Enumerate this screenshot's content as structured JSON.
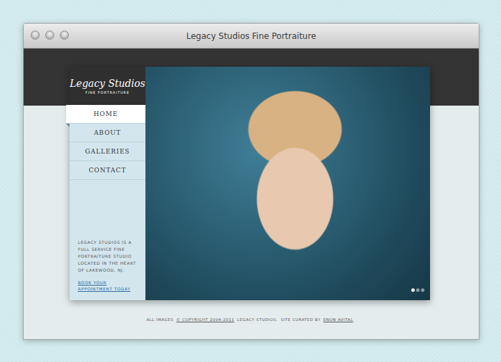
{
  "window": {
    "title": "Legacy Studios Fine Portraiture"
  },
  "logo": {
    "name": "Legacy Studios",
    "tagline": "FINE PORTRAITURE"
  },
  "nav": [
    {
      "label": "HOME",
      "selected": true
    },
    {
      "label": "ABOUT",
      "selected": false
    },
    {
      "label": "GALLERIES",
      "selected": false
    },
    {
      "label": "CONTACT",
      "selected": false
    }
  ],
  "sidebar": {
    "about": "LEGACY STUDIOS IS A FULL SERVICE FINE PORTRAITURE STUDIO LOCATED IN THE HEART OF LAKEWOOD, NJ.",
    "cta": "BOOK YOUR APPOINTMENT TODAY"
  },
  "slides": [
    {
      "selected": true
    },
    {
      "selected": false
    },
    {
      "selected": false
    }
  ],
  "footer": {
    "prefix": "ALL IMAGES",
    "copyright": "© COPYRIGHT 2004-2011",
    "owner": "LEGACY STUDIOS.",
    "credit_label": "SITE CURATED BY",
    "credit_name": "ENON AVITAL"
  }
}
